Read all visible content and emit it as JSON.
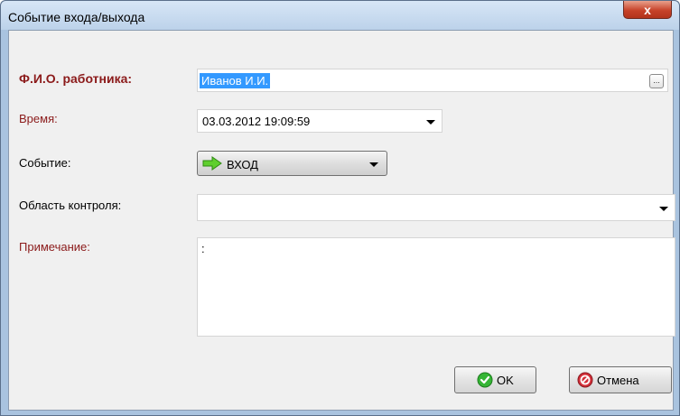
{
  "window": {
    "title": "Событие входа/выхода",
    "close_label": "x"
  },
  "form": {
    "employee_label": "Ф.И.О. работника:",
    "employee_value": "Иванов И.И.",
    "browse_label": "...",
    "time_label": "Время:",
    "time_value": "03.03.2012 19:09:59",
    "event_label": "Событие:",
    "event_value": "ВХОД",
    "area_label": "Область контроля:",
    "area_value": "",
    "note_label": "Примечание:",
    "note_value": ":"
  },
  "buttons": {
    "ok_label": "OK",
    "cancel_label": "Отмена"
  },
  "colors": {
    "required_label": "#8b1a1a",
    "selection": "#3399ff",
    "close_button": "#c7432a",
    "arrow_icon": "#5fcf2e",
    "ok_icon": "#35b535",
    "cancel_icon": "#d4303a"
  },
  "icons": {
    "event": "green-right-arrow-icon",
    "ok": "green-check-icon",
    "cancel": "red-no-icon"
  }
}
